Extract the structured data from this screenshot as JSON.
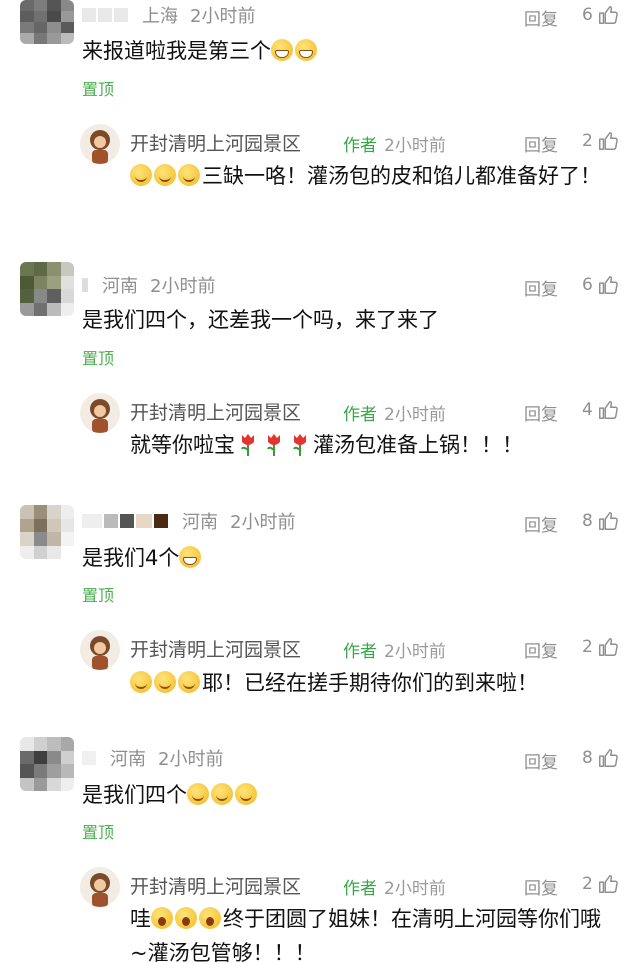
{
  "colors": {
    "accent_green": "#4caf50",
    "author_green": "#38a847",
    "meta_gray": "#8f8f8f"
  },
  "threads": [
    {
      "comment": {
        "location": "上海",
        "time": "2小时前",
        "text": "来报道啦我是第三个",
        "pin_label": "置顶",
        "reply_label": "回复",
        "likes": "6",
        "emojis": [
          "grin-face-icon",
          "grin-face-icon"
        ]
      },
      "reply": {
        "name": "开封清明上河园景区",
        "author_tag": "作者",
        "time": "2小时前",
        "text": "三缺一咯！灌汤包的皮和馅儿都准备好了！",
        "reply_label": "回复",
        "likes": "2",
        "emojis": [
          "wink-face-icon",
          "wink-face-icon",
          "wink-face-icon"
        ]
      }
    },
    {
      "comment": {
        "location": "河南",
        "time": "2小时前",
        "text": "是我们四个，还差我一个吗，来了来了",
        "pin_label": "置顶",
        "reply_label": "回复",
        "likes": "6"
      },
      "reply": {
        "name": "开封清明上河园景区",
        "author_tag": "作者",
        "time": "2小时前",
        "text_a": "就等你啦宝",
        "text_b": "灌汤包准备上锅！！！",
        "reply_label": "回复",
        "likes": "4",
        "emojis": [
          "tulip-icon",
          "tulip-icon",
          "tulip-icon"
        ]
      }
    },
    {
      "comment": {
        "location": "河南",
        "time": "2小时前",
        "text": "是我们4个",
        "pin_label": "置顶",
        "reply_label": "回复",
        "likes": "8",
        "emojis": [
          "grin-face-icon"
        ]
      },
      "reply": {
        "name": "开封清明上河园景区",
        "author_tag": "作者",
        "time": "2小时前",
        "text": "耶！已经在搓手期待你们的到来啦！",
        "reply_label": "回复",
        "likes": "2",
        "emojis": [
          "smile-face-icon",
          "smile-face-icon",
          "smile-face-icon"
        ]
      }
    },
    {
      "comment": {
        "location": "河南",
        "time": "2小时前",
        "text": "是我们四个",
        "pin_label": "置顶",
        "reply_label": "回复",
        "likes": "8",
        "emojis": [
          "smile-face-icon",
          "smile-face-icon",
          "smile-face-icon"
        ]
      },
      "reply": {
        "name": "开封清明上河园景区",
        "author_tag": "作者",
        "time": "2小时前",
        "text_a": "哇",
        "text_b": "终于团圆了姐妹！在清明上河园等你们哦~灌汤包管够！！！",
        "reply_label": "回复",
        "likes": "2",
        "emojis": [
          "wow-face-icon",
          "wow-face-icon",
          "wow-face-icon"
        ]
      }
    }
  ]
}
